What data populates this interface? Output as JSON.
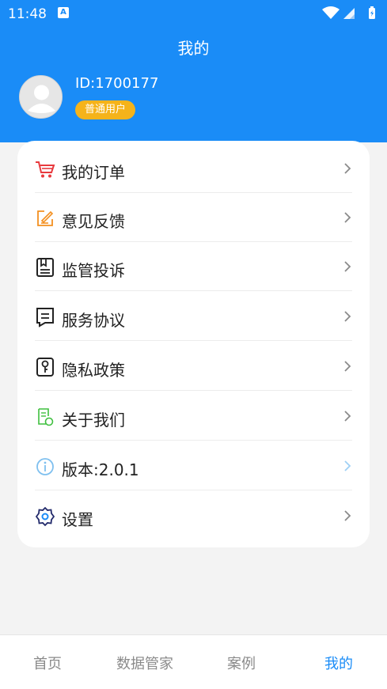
{
  "status_bar": {
    "time": "11:48",
    "notification_icon": "A",
    "icons": [
      "wifi-icon",
      "signal-icon",
      "battery-icon"
    ]
  },
  "page": {
    "title": "我的"
  },
  "profile": {
    "id": "ID:1700177",
    "role_badge": "普通用户"
  },
  "menu": {
    "items": [
      {
        "label": "我的订单",
        "icon": "cart-icon",
        "color": "#e8393d"
      },
      {
        "label": "意见反馈",
        "icon": "edit-icon",
        "color": "#f39020"
      },
      {
        "label": "监管投诉",
        "icon": "bookmark-doc-icon",
        "color": "#222222"
      },
      {
        "label": "服务协议",
        "icon": "document-icon",
        "color": "#222222"
      },
      {
        "label": "隐私政策",
        "icon": "key-icon",
        "color": "#222222"
      },
      {
        "label": "关于我们",
        "icon": "info-doc-icon",
        "color": "#3fbf3f"
      },
      {
        "label": "版本:2.0.1",
        "icon": "info-circle-icon",
        "color": "#7fc0ef"
      },
      {
        "label": "设置",
        "icon": "gear-icon",
        "color": "#222a6b"
      }
    ]
  },
  "tab_bar": {
    "tabs": [
      {
        "label": "首页",
        "active": false
      },
      {
        "label": "数据管家",
        "active": false
      },
      {
        "label": "案例",
        "active": false
      },
      {
        "label": "我的",
        "active": true
      }
    ]
  },
  "colors": {
    "accent": "#1a8cf7",
    "badge": "#f5b31a",
    "background": "#f3f3f3"
  }
}
